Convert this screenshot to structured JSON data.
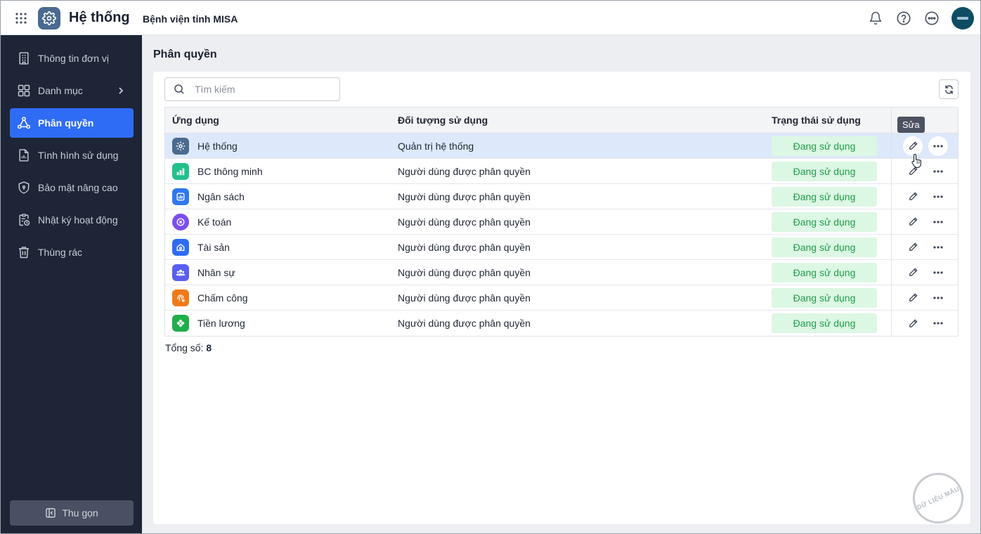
{
  "header": {
    "app_title": "Hệ thống",
    "org_name": "Bệnh viện tỉnh MISA"
  },
  "sidebar": {
    "items": [
      {
        "label": "Thông tin đơn vị",
        "icon": "building-icon"
      },
      {
        "label": "Danh mục",
        "icon": "grid-icon"
      },
      {
        "label": "Phân quyền",
        "icon": "permission-nodes-icon",
        "active": true
      },
      {
        "label": "Tình hình sử dụng",
        "icon": "document-chart-icon"
      },
      {
        "label": "Bảo mật nâng cao",
        "icon": "shield-icon"
      },
      {
        "label": "Nhật ký hoạt động",
        "icon": "clipboard-clock-icon"
      },
      {
        "label": "Thùng rác",
        "icon": "trash-icon"
      }
    ],
    "collapse_label": "Thu gọn"
  },
  "main": {
    "page_title": "Phân quyền",
    "search_placeholder": "Tìm kiếm",
    "columns": {
      "app": "Ứng dụng",
      "object": "Đối tượng sử dụng",
      "status": "Trạng thái sử dụng"
    },
    "rows": [
      {
        "app": "Hệ thống",
        "object": "Quản trị hệ thống",
        "status": "Đang sử dụng",
        "color": "#4a6a8f"
      },
      {
        "app": "BC thông minh",
        "object": "Người dùng được phân quyền",
        "status": "Đang sử dụng",
        "color": "#22c08a"
      },
      {
        "app": "Ngân sách",
        "object": "Người dùng được phân quyền",
        "status": "Đang sử dụng",
        "color": "#2f78f0"
      },
      {
        "app": "Kế toán",
        "object": "Người dùng được phân quyền",
        "status": "Đang sử dụng",
        "color": "#7a4ff0"
      },
      {
        "app": "Tài sản",
        "object": "Người dùng được phân quyền",
        "status": "Đang sử dụng",
        "color": "#2f6cf5"
      },
      {
        "app": "Nhân sự",
        "object": "Người dùng được phân quyền",
        "status": "Đang sử dụng",
        "color": "#5a5ff0"
      },
      {
        "app": "Chấm công",
        "object": "Người dùng được phân quyền",
        "status": "Đang sử dụng",
        "color": "#f07a1a"
      },
      {
        "app": "Tiền lương",
        "object": "Người dùng được phân quyền",
        "status": "Đang sử dụng",
        "color": "#1fae4a"
      }
    ],
    "tooltip": "Sửa",
    "total_label": "Tổng số:",
    "total_value": "8"
  },
  "watermark": "DỮ LIỆU MẪU"
}
